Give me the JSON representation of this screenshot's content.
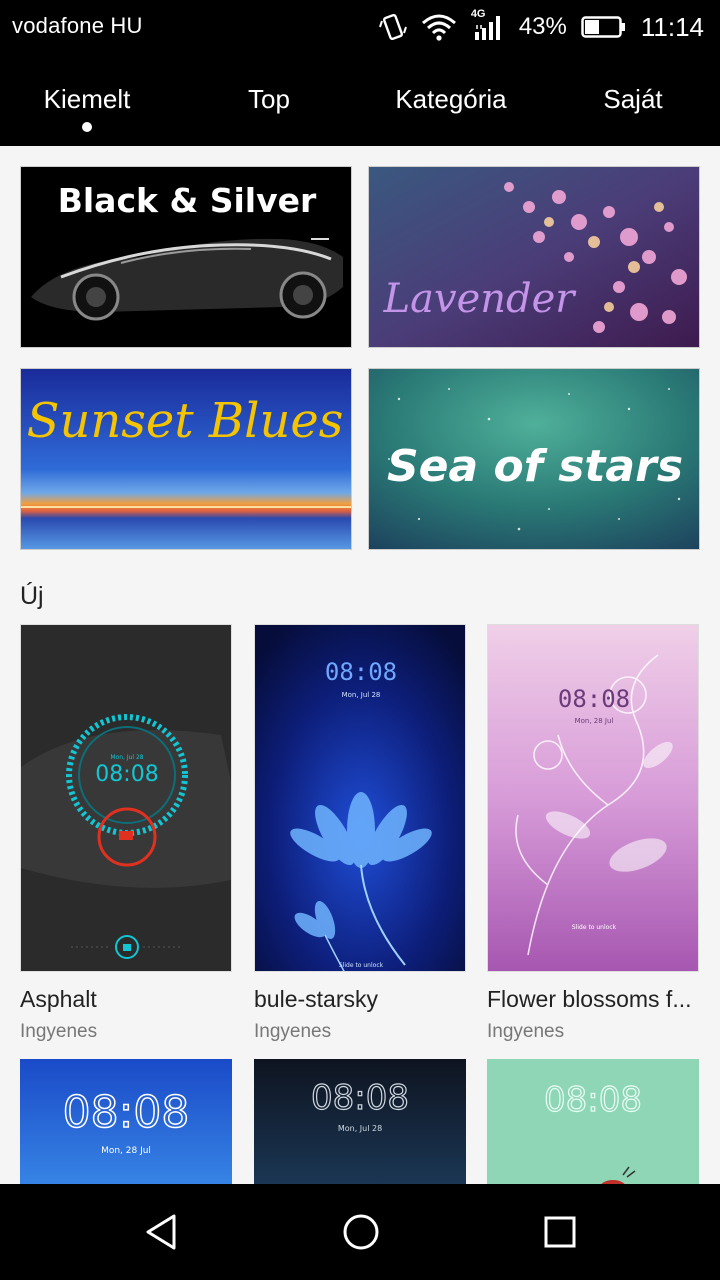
{
  "status": {
    "carrier": "vodafone HU",
    "network": "4G",
    "battery": "43%",
    "battery_level": 0.43,
    "time": "11:14"
  },
  "tabs": [
    {
      "label": "Kiemelt",
      "selected": true
    },
    {
      "label": "Top",
      "selected": false
    },
    {
      "label": "Kategória",
      "selected": false
    },
    {
      "label": "Saját",
      "selected": false
    }
  ],
  "banners": [
    {
      "title": "Black & Silver"
    },
    {
      "title": "Lavender"
    },
    {
      "title": "Sunset Blues"
    },
    {
      "title": "Sea of stars"
    }
  ],
  "section": {
    "title": "Új"
  },
  "themes": [
    {
      "name": "Asphalt",
      "price": "Ingyenes",
      "clock": "08:08",
      "date": "Mon, Jul 28"
    },
    {
      "name": "bule-starsky",
      "price": "Ingyenes",
      "clock": "08:08",
      "date": "Mon, Jul 28",
      "caption": "Slide to unlock"
    },
    {
      "name": "Flower blossoms f...",
      "price": "Ingyenes",
      "clock": "08:08",
      "date": "Mon, 28 Jul",
      "caption": "Slide to unlock"
    }
  ],
  "themes_row2": [
    {
      "clock": "08:08",
      "date": "Mon, 28 Jul"
    },
    {
      "clock": "08:08",
      "date": "Mon, Jul 28"
    },
    {
      "clock": "08:08"
    }
  ],
  "nav": {
    "back": "back-icon",
    "home": "home-icon",
    "recents": "recents-icon"
  }
}
